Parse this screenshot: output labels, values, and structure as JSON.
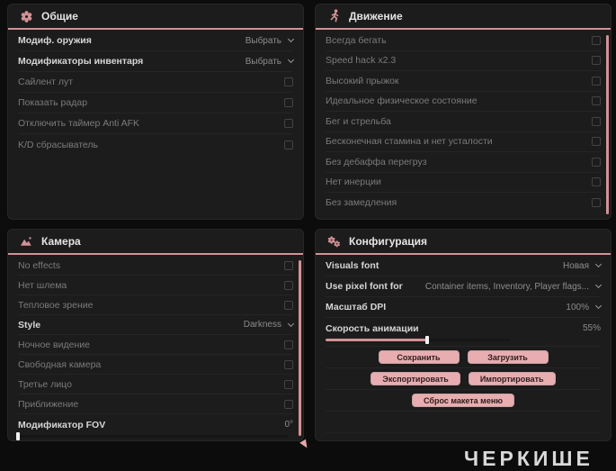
{
  "colors": {
    "accent": "#d29296",
    "button_bg": "#e7adb0",
    "button_text": "#2e1c1d",
    "panel_bg": "#1c1c1c",
    "page_bg": "#0c0c0c"
  },
  "panels": {
    "general": {
      "title": "Общие",
      "icon": "flower-gear-icon",
      "rows": [
        {
          "label": "Модиф. оружия",
          "type": "dropdown",
          "value": "Выбрать"
        },
        {
          "label": "Модификаторы инвентаря",
          "type": "dropdown",
          "value": "Выбрать"
        },
        {
          "label": "Сайлент лут",
          "type": "checkbox",
          "checked": false
        },
        {
          "label": "Показать радар",
          "type": "checkbox",
          "checked": false
        },
        {
          "label": "Отключить таймер Anti AFK",
          "type": "checkbox",
          "checked": false
        },
        {
          "label": "K/D сбрасыватель",
          "type": "checkbox",
          "checked": false
        }
      ]
    },
    "movement": {
      "title": "Движение",
      "icon": "runner-icon",
      "rows": [
        {
          "label": "Всегда бегать",
          "type": "checkbox",
          "checked": false
        },
        {
          "label": "Speed hack x2.3",
          "type": "checkbox",
          "checked": false
        },
        {
          "label": "Высокий прыжок",
          "type": "checkbox",
          "checked": false
        },
        {
          "label": "Идеальное физическое состояние",
          "type": "checkbox",
          "checked": false
        },
        {
          "label": "Бег и стрельба",
          "type": "checkbox",
          "checked": false
        },
        {
          "label": "Бесконечная стамина и нет усталости",
          "type": "checkbox",
          "checked": false
        },
        {
          "label": "Без дебаффа перегруз",
          "type": "checkbox",
          "checked": false
        },
        {
          "label": "Нет инерции",
          "type": "checkbox",
          "checked": false
        },
        {
          "label": "Без замедления",
          "type": "checkbox",
          "checked": false
        }
      ]
    },
    "camera": {
      "title": "Камера",
      "icon": "image-icon",
      "rows": [
        {
          "label": "No effects",
          "type": "checkbox",
          "checked": false
        },
        {
          "label": "Нет шлема",
          "type": "checkbox",
          "checked": false
        },
        {
          "label": "Тепловое зрение",
          "type": "checkbox",
          "checked": false
        },
        {
          "label": "Style",
          "type": "dropdown",
          "value": "Darkness"
        },
        {
          "label": "Ночное видение",
          "type": "checkbox",
          "checked": false
        },
        {
          "label": "Свободная камера",
          "type": "checkbox",
          "checked": false
        },
        {
          "label": "Третье лицо",
          "type": "checkbox",
          "checked": false
        },
        {
          "label": "Приближение",
          "type": "checkbox",
          "checked": false
        }
      ],
      "fov_slider": {
        "label": "Модификатор FOV",
        "value": "0°",
        "percent": 0
      }
    },
    "config": {
      "title": "Конфигурация",
      "icon": "gears-icon",
      "rows": [
        {
          "label": "Visuals font",
          "type": "dropdown",
          "value": "Новая"
        },
        {
          "label": "Use pixel font for",
          "type": "dropdown",
          "value": "Container items, Inventory, Player flags..."
        },
        {
          "label": "Масштаб DPI",
          "type": "dropdown",
          "value": "100%"
        }
      ],
      "anim_slider": {
        "label": "Скорость анимации",
        "value": "55%",
        "percent": 55
      },
      "buttons": {
        "save": "Сохранить",
        "load": "Загрузить",
        "export": "Экспортировать",
        "import": "Импортировать",
        "reset": "Сброс макета меню"
      }
    }
  },
  "background": {
    "bottom_text": "ЧЕРКИШЕ"
  }
}
